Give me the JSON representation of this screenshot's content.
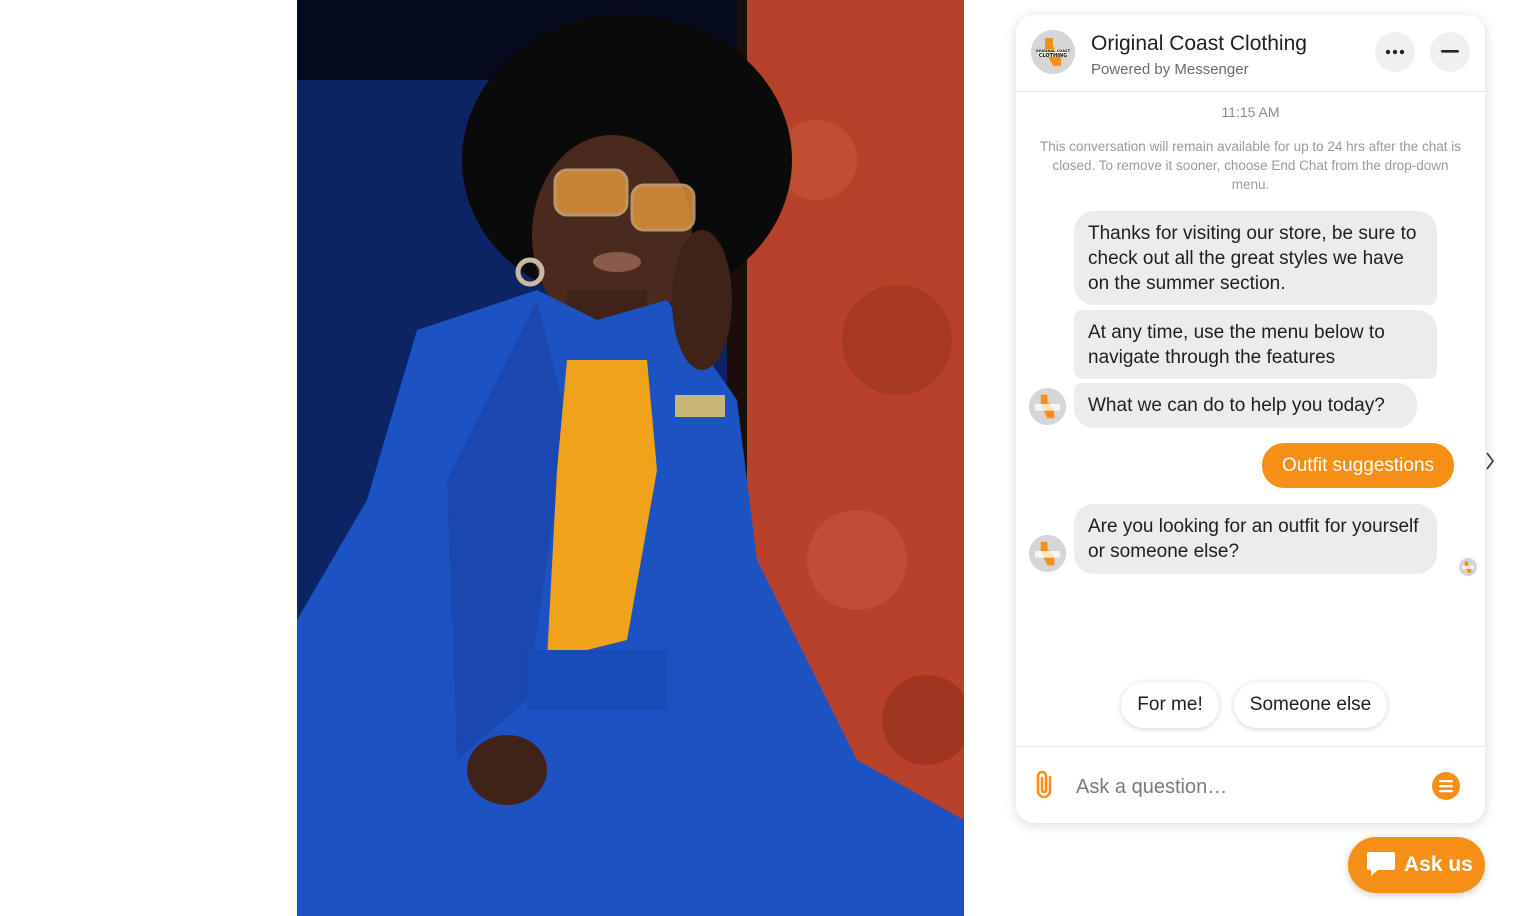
{
  "hero_image": {
    "alt": ""
  },
  "chat": {
    "brand_name": "Original Coast Clothing",
    "subtitle": "Powered by Messenger",
    "logo_text_top": "ORIGINAL COAST",
    "logo_text_bottom": "CLOTHING",
    "timestamp": "11:15 AM",
    "notice": "This conversation will remain available for up to 24 hrs after the chat is closed. To remove it sooner, choose End Chat from the drop-down menu.",
    "messages": [
      {
        "from": "bot",
        "text": "Thanks for visiting our store, be sure to check out all the great styles we have on the summer section."
      },
      {
        "from": "bot",
        "text": "At any time, use the menu below to navigate through the features"
      },
      {
        "from": "bot",
        "text": "What we can do to help you today?"
      },
      {
        "from": "user",
        "text": "Outfit suggestions"
      },
      {
        "from": "bot",
        "text": "Are you looking for an outfit for yourself or someone else?"
      }
    ],
    "quick_replies": [
      "For me!",
      "Someone else"
    ],
    "composer": {
      "placeholder": "Ask a question…"
    },
    "icons": {
      "more": "more-dots-icon",
      "minimize": "minimize-icon",
      "attach": "paperclip-icon",
      "menu": "menu-icon",
      "next": "chevron-right-icon",
      "ask": "chat-bubble-icon"
    }
  },
  "launcher": {
    "label": "Ask us"
  },
  "colors": {
    "accent": "#f68f16",
    "bubble": "#ececec",
    "text": "#1c1e21",
    "muted": "#9a9a9a"
  }
}
